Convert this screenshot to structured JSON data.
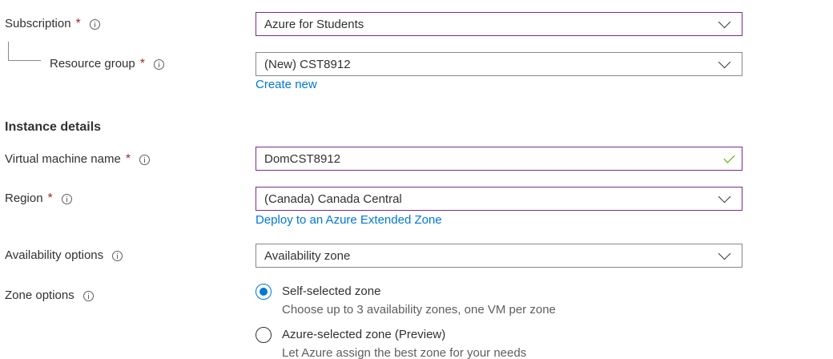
{
  "fields": {
    "subscription": {
      "label": "Subscription",
      "required": "*",
      "value": "Azure for Students"
    },
    "resource_group": {
      "label": "Resource group",
      "required": "*",
      "value": "(New) CST8912",
      "link": "Create new"
    },
    "vm_name": {
      "label": "Virtual machine name",
      "required": "*",
      "value": "DomCST8912"
    },
    "region": {
      "label": "Region",
      "required": "*",
      "value": "(Canada) Canada Central",
      "link": "Deploy to an Azure Extended Zone"
    },
    "availability": {
      "label": "Availability options",
      "value": "Availability zone"
    },
    "zone": {
      "label": "Zone options",
      "options": [
        {
          "title": "Self-selected zone",
          "desc": "Choose up to 3 availability zones, one VM per zone",
          "selected": true
        },
        {
          "title": "Azure-selected zone (Preview)",
          "desc": "Let Azure assign the best zone for your needs",
          "selected": false
        }
      ]
    }
  },
  "section": {
    "instance_details": "Instance details"
  },
  "colors": {
    "accent": "#0078d4",
    "required": "#a4262c",
    "focus_border": "#7b2b8c",
    "valid_check": "#57a300"
  },
  "icons": {
    "info": "info-icon",
    "dropdown": "chevron-down-icon",
    "valid": "checkmark-icon"
  }
}
